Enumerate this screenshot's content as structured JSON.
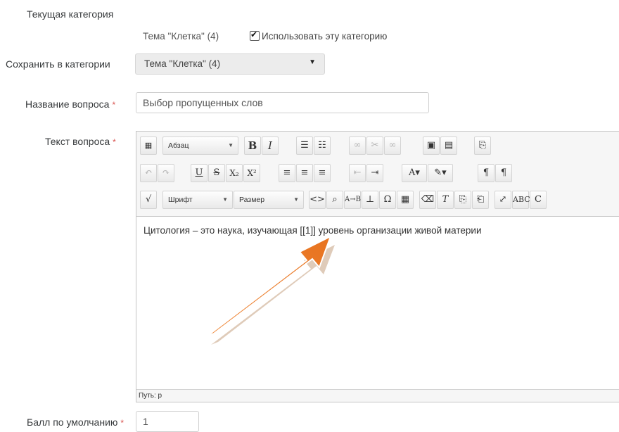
{
  "current_category": {
    "label": "Текущая категория",
    "value": "Тема \"Клетка\" (4)",
    "use_label": "Использовать эту категорию",
    "use_checked": true
  },
  "save_category": {
    "label": "Сохранить в категории",
    "selected": "Тема \"Клетка\" (4)"
  },
  "question_name": {
    "label": "Название вопроса",
    "value": "Выбор пропущенных слов"
  },
  "question_text": {
    "label": "Текст вопроса",
    "toolbar": {
      "format_select": "Абзац",
      "font_select": "Шрифт",
      "size_select": "Размер"
    },
    "content": "Цитология – это наука, изучающая [[1]] уровень организации живой материи",
    "path": "Путь: p"
  },
  "default_mark": {
    "label": "Балл по умолчанию",
    "value": "1"
  },
  "required_marker": "*",
  "colors": {
    "required": "#d9534f",
    "annotation_arrow": "#ec7a2b"
  },
  "icons": [
    "checkbox-icon",
    "dropdown-arrow-icon",
    "bold-icon",
    "italic-icon",
    "bullet-list-icon",
    "numbered-list-icon",
    "link-icon",
    "unlink-icon",
    "image-icon",
    "media-icon",
    "paste-icon",
    "undo-icon",
    "redo-icon",
    "underline-icon",
    "strikethrough-icon",
    "subscript-icon",
    "superscript-icon",
    "align-left-icon",
    "align-center-icon",
    "align-right-icon",
    "outdent-icon",
    "indent-icon",
    "text-color-icon",
    "background-color-icon",
    "ltr-icon",
    "rtl-icon",
    "equation-icon",
    "code-icon",
    "find-icon",
    "charmap-icon",
    "table-icon",
    "clean-icon",
    "clear-format-icon",
    "paste-text-icon",
    "paste-word-icon",
    "fullscreen-icon",
    "spellcheck-icon"
  ]
}
